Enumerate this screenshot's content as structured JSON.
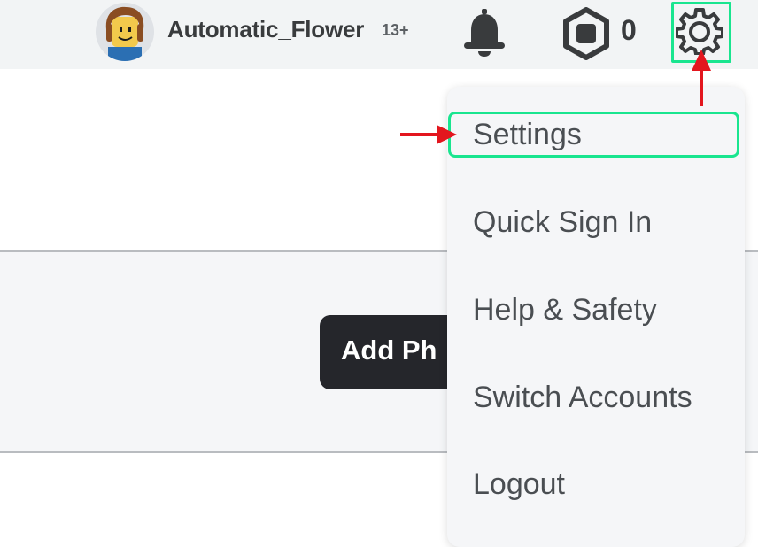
{
  "header": {
    "username": "Automatic_Flower",
    "age_badge": "13+",
    "robux_count": "0",
    "avatar_icon": "avatar-icon",
    "notifications_icon": "bell-icon",
    "robux_icon": "robux-icon",
    "settings_icon": "gear-icon"
  },
  "main": {
    "add_photo_label": "Add Ph"
  },
  "dropdown": {
    "items": [
      {
        "label": "Settings"
      },
      {
        "label": "Quick Sign In"
      },
      {
        "label": "Help & Safety"
      },
      {
        "label": "Switch Accounts"
      },
      {
        "label": "Logout"
      }
    ]
  },
  "annotations": {
    "highlight_color": "#19e58f",
    "arrow_color": "#e3161e"
  }
}
